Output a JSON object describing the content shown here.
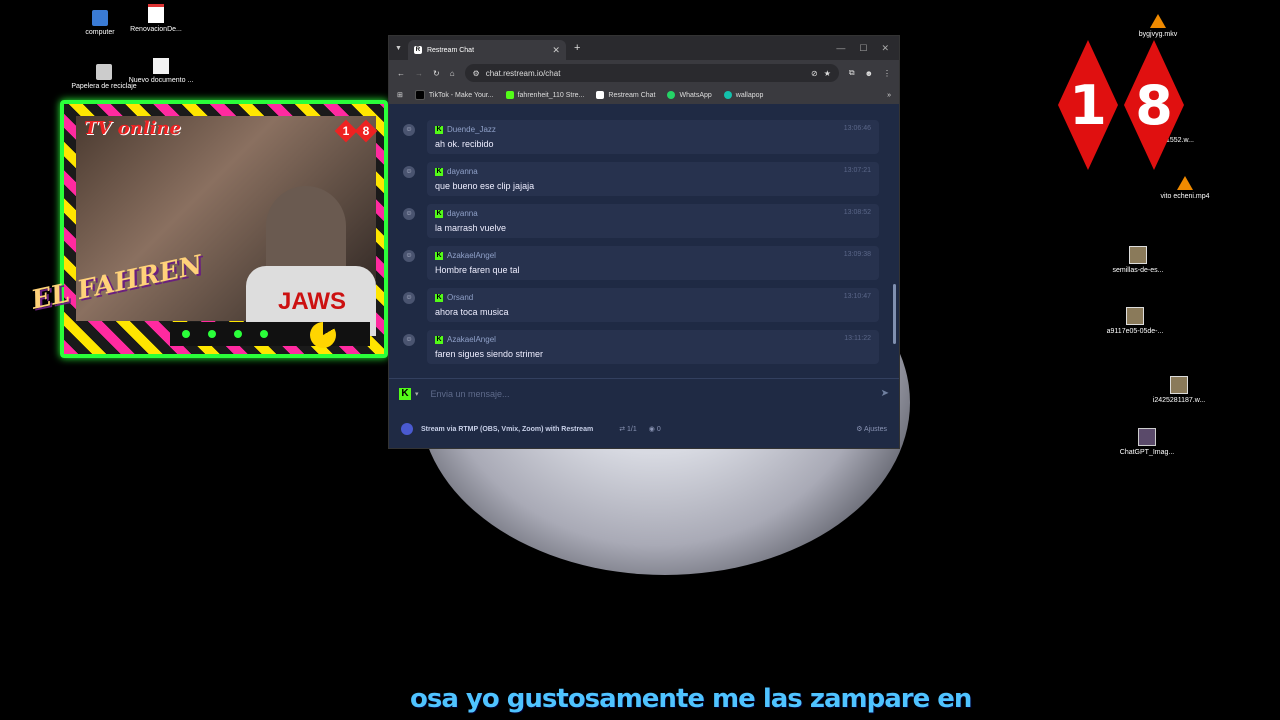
{
  "desktop": {
    "icons_left": [
      {
        "label": "computer",
        "icon": "computer-icon"
      },
      {
        "label": "RenovacionDe...",
        "icon": "pdf-icon"
      },
      {
        "label": "Papelera de reciclaje",
        "icon": "recycle-bin-icon"
      },
      {
        "label": "Nuevo documento ...",
        "icon": "document-icon"
      }
    ],
    "icons_right": [
      {
        "label": "bygjvyg.mkv",
        "icon": "vlc-icon"
      },
      {
        "label": "1552.w...",
        "icon": "file-icon"
      },
      {
        "label": "vito echeni.mp4",
        "icon": "vlc-icon"
      },
      {
        "label": "semillas-de-es...",
        "icon": "image-icon"
      },
      {
        "label": "a9117e05-05de-...",
        "icon": "image-icon"
      },
      {
        "label": "i2425281187.w...",
        "icon": "image-icon"
      },
      {
        "label": "ChatGPT_Imag...",
        "icon": "image-icon"
      }
    ],
    "big_badge": {
      "digit1": "1",
      "digit2": "8",
      "color": "#e01010"
    }
  },
  "overlay": {
    "tv_label": "TV online",
    "badge": {
      "d1": "1",
      "d2": "8"
    },
    "shirt_text": "JAWS",
    "logo_text": "EL FAHREN",
    "accent": "#2aff3a"
  },
  "browser": {
    "tab_title": "Restream Chat",
    "tab_favicon": "R",
    "url": "chat.restream.io/chat",
    "bookmarks": [
      {
        "label": "TikTok - Make Your...",
        "color": "#000000"
      },
      {
        "label": "fahrenheit_110 Stre...",
        "color": "#53fc18"
      },
      {
        "label": "Restream Chat",
        "color": "#ffffff"
      },
      {
        "label": "WhatsApp",
        "color": "#25d366"
      },
      {
        "label": "wallapop",
        "color": "#13c1ac"
      }
    ],
    "bookmarks_more": "»"
  },
  "chat": {
    "messages": [
      {
        "user": "Duende_Jazz",
        "time": "13:06:46",
        "text": "ah ok. recibido"
      },
      {
        "user": "dayanna",
        "time": "13:07:21",
        "text": "que bueno ese clip jajaja"
      },
      {
        "user": "dayanna",
        "time": "13:08:52",
        "text": "la marrash vuelve"
      },
      {
        "user": "AzakaelAngel",
        "time": "13:09:38",
        "text": "Hombre faren que tal"
      },
      {
        "user": "Orsand",
        "time": "13:10:47",
        "text": "ahora toca musica"
      },
      {
        "user": "AzakaelAngel",
        "time": "13:11:22",
        "text": "faren sigues siendo strimer"
      }
    ],
    "input_placeholder": "Envia un mensaje...",
    "footer_label": "Stream via RTMP (OBS, Vmix, Zoom) with Restream",
    "footer_count": "1/1",
    "footer_viewers": "0",
    "footer_settings": "Ajustes",
    "platform_color": "#53fc18"
  },
  "subtitle": "osa yo gustosamente me las zampare en"
}
